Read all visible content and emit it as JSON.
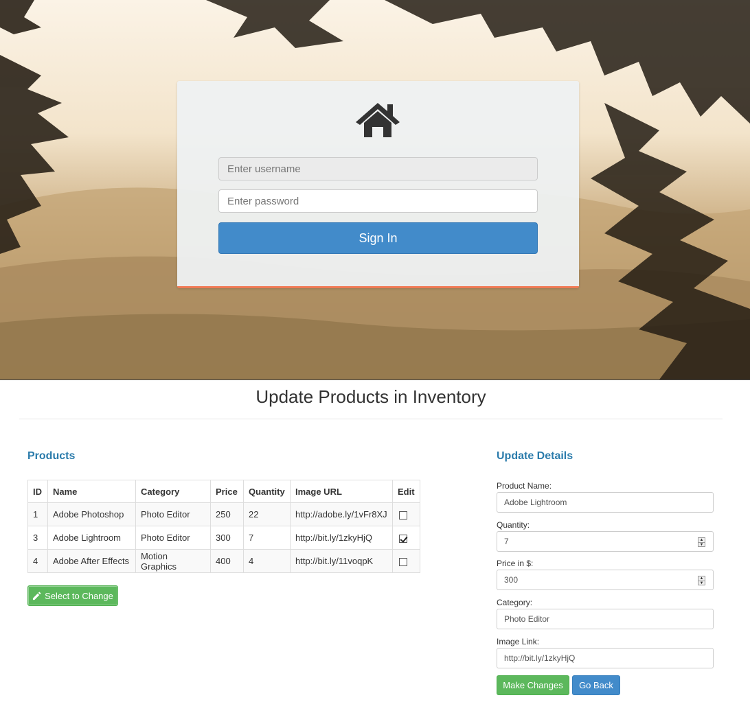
{
  "login": {
    "username_placeholder": "Enter username",
    "password_placeholder": "Enter password",
    "signin_label": "Sign In",
    "icon": "home-icon"
  },
  "page": {
    "title": "Update Products in Inventory"
  },
  "products": {
    "heading": "Products",
    "columns": [
      "ID",
      "Name",
      "Category",
      "Price",
      "Quantity",
      "Image URL",
      "Edit"
    ],
    "rows": [
      {
        "id": "1",
        "name": "Adobe Photoshop",
        "category": "Photo Editor",
        "price": "250",
        "quantity": "22",
        "image_url": "http://adobe.ly/1vFr8XJ",
        "edit": false
      },
      {
        "id": "3",
        "name": "Adobe Lightroom",
        "category": "Photo Editor",
        "price": "300",
        "quantity": "7",
        "image_url": "http://bit.ly/1zkyHjQ",
        "edit": true
      },
      {
        "id": "4",
        "name": "Adobe After Effects",
        "category": "Motion Graphics",
        "price": "400",
        "quantity": "4",
        "image_url": "http://bit.ly/11voqpK",
        "edit": false
      }
    ],
    "select_button_label": "Select to Change"
  },
  "details": {
    "heading": "Update Details",
    "product_name_label": "Product Name:",
    "product_name_value": "Adobe Lightroom",
    "quantity_label": "Quantity:",
    "quantity_value": "7",
    "price_label": "Price in $:",
    "price_value": "300",
    "category_label": "Category:",
    "category_value": "Photo Editor",
    "image_link_label": "Image Link:",
    "image_link_value": "http://bit.ly/1zkyHjQ",
    "make_changes_label": "Make Changes",
    "go_back_label": "Go Back"
  },
  "colors": {
    "primary_blue": "#428bca",
    "success_green": "#5cb85c",
    "heading_blue": "#2a7bab",
    "card_accent": "#f07a55"
  }
}
